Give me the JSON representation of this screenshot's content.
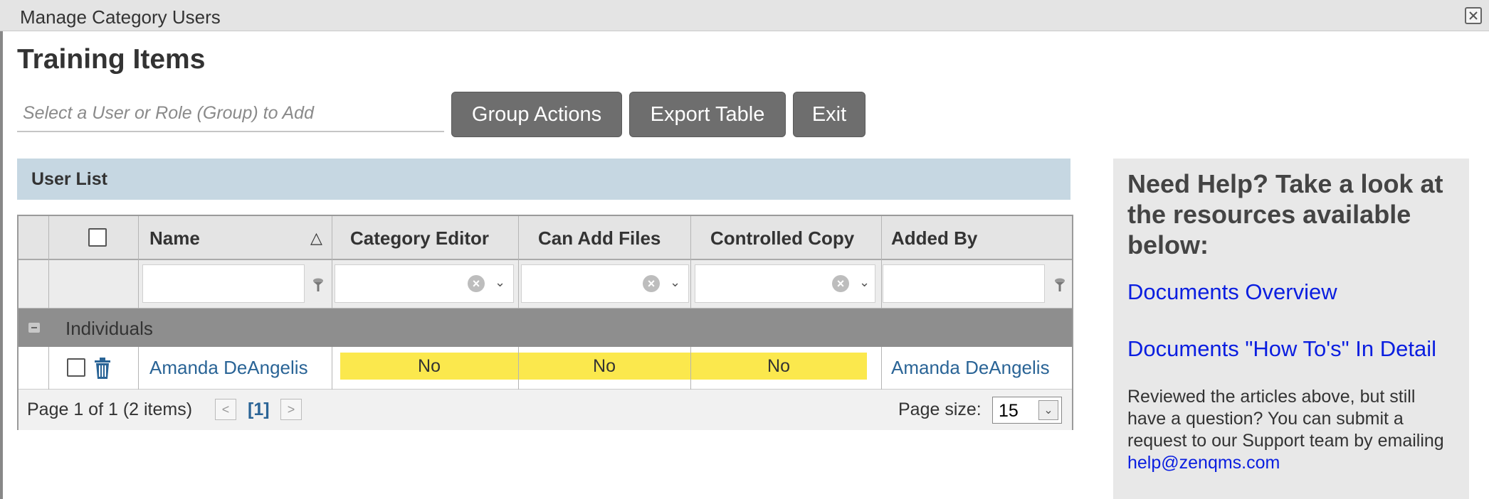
{
  "window": {
    "title": "Manage Category Users"
  },
  "page": {
    "title": "Training Items"
  },
  "search": {
    "placeholder": "Select a User or Role (Group) to Add"
  },
  "buttons": {
    "group_actions": "Group Actions",
    "export_table": "Export Table",
    "exit": "Exit"
  },
  "user_list": {
    "title": "User List"
  },
  "grid": {
    "columns": [
      "Name",
      "Category Editor",
      "Can Add Files",
      "Controlled Copy",
      "Added By"
    ],
    "group_label": "Individuals",
    "rows": [
      {
        "name": "Amanda DeAngelis",
        "category_editor": "No",
        "can_add_files": "No",
        "controlled_copy": "No",
        "added_by": "Amanda DeAngelis"
      }
    ]
  },
  "pager": {
    "summary": "Page 1 of 1 (2 items)",
    "prev": "<",
    "current": "[1]",
    "next": ">",
    "page_size_label": "Page size:",
    "page_size": "15"
  },
  "help": {
    "heading": "Need Help? Take a look at the resources available below:",
    "link1": "Documents Overview",
    "link2": "Documents \"How To's\" In Detail",
    "text": "Reviewed the articles above, but still have a question? You can submit a request to our Support team by emailing",
    "email": "help@zenqms.com"
  },
  "colors": {
    "highlight": "#fbe84d",
    "link": "#2a6496",
    "help_link": "#0a1ee0",
    "button": "#6e6e6e",
    "list_header": "#c6d7e2"
  }
}
